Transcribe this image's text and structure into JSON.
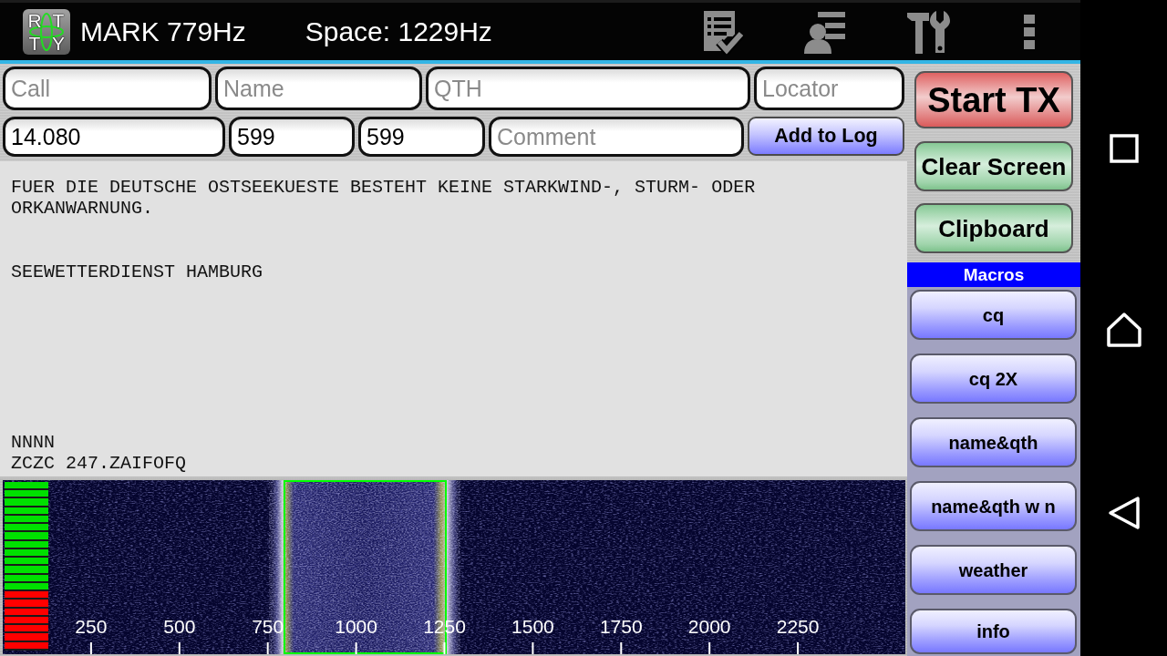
{
  "action_bar": {
    "logo_letters": [
      "R",
      "T",
      "T",
      "Y"
    ],
    "mark": "MARK 779Hz",
    "space": "Space: 1229Hz"
  },
  "log_form": {
    "top_fields": [
      {
        "placeholder": "Call"
      },
      {
        "placeholder": "Name"
      },
      {
        "placeholder": "QTH"
      },
      {
        "placeholder": "Locator"
      }
    ],
    "bottom_fields": [
      {
        "value": "14.080"
      },
      {
        "value": "599"
      },
      {
        "value": "599"
      },
      {
        "placeholder": "Comment"
      }
    ],
    "add_button": "Add to Log"
  },
  "received_text": "FUER DIE DEUTSCHE OSTSEEKUESTE BESTEHT KEINE STARKWIND-, STURM- ODER\nORKANWARNUNG.\n\n\nSEEWETTERDIENST HAMBURG\n\n\n\n\n\n\n\nNNNN\nZCZC 247.ZAIFOFQ",
  "waterfall": {
    "signal_meter": {
      "level": 0.65
    },
    "frequency_labels": [
      "250",
      "500",
      "750",
      "1000",
      "1250",
      "1500",
      "1750",
      "2000",
      "2250"
    ]
  },
  "side_buttons": [
    {
      "label": "Start TX",
      "kind": "transmit"
    },
    {
      "label": "Clear Screen",
      "kind": "action"
    },
    {
      "label": "Clipboard",
      "kind": "action"
    }
  ],
  "macros": {
    "title": "Macros",
    "buttons": [
      "cq",
      "cq 2X",
      "name&qth",
      "name&qth w n",
      "weather",
      "info"
    ]
  }
}
